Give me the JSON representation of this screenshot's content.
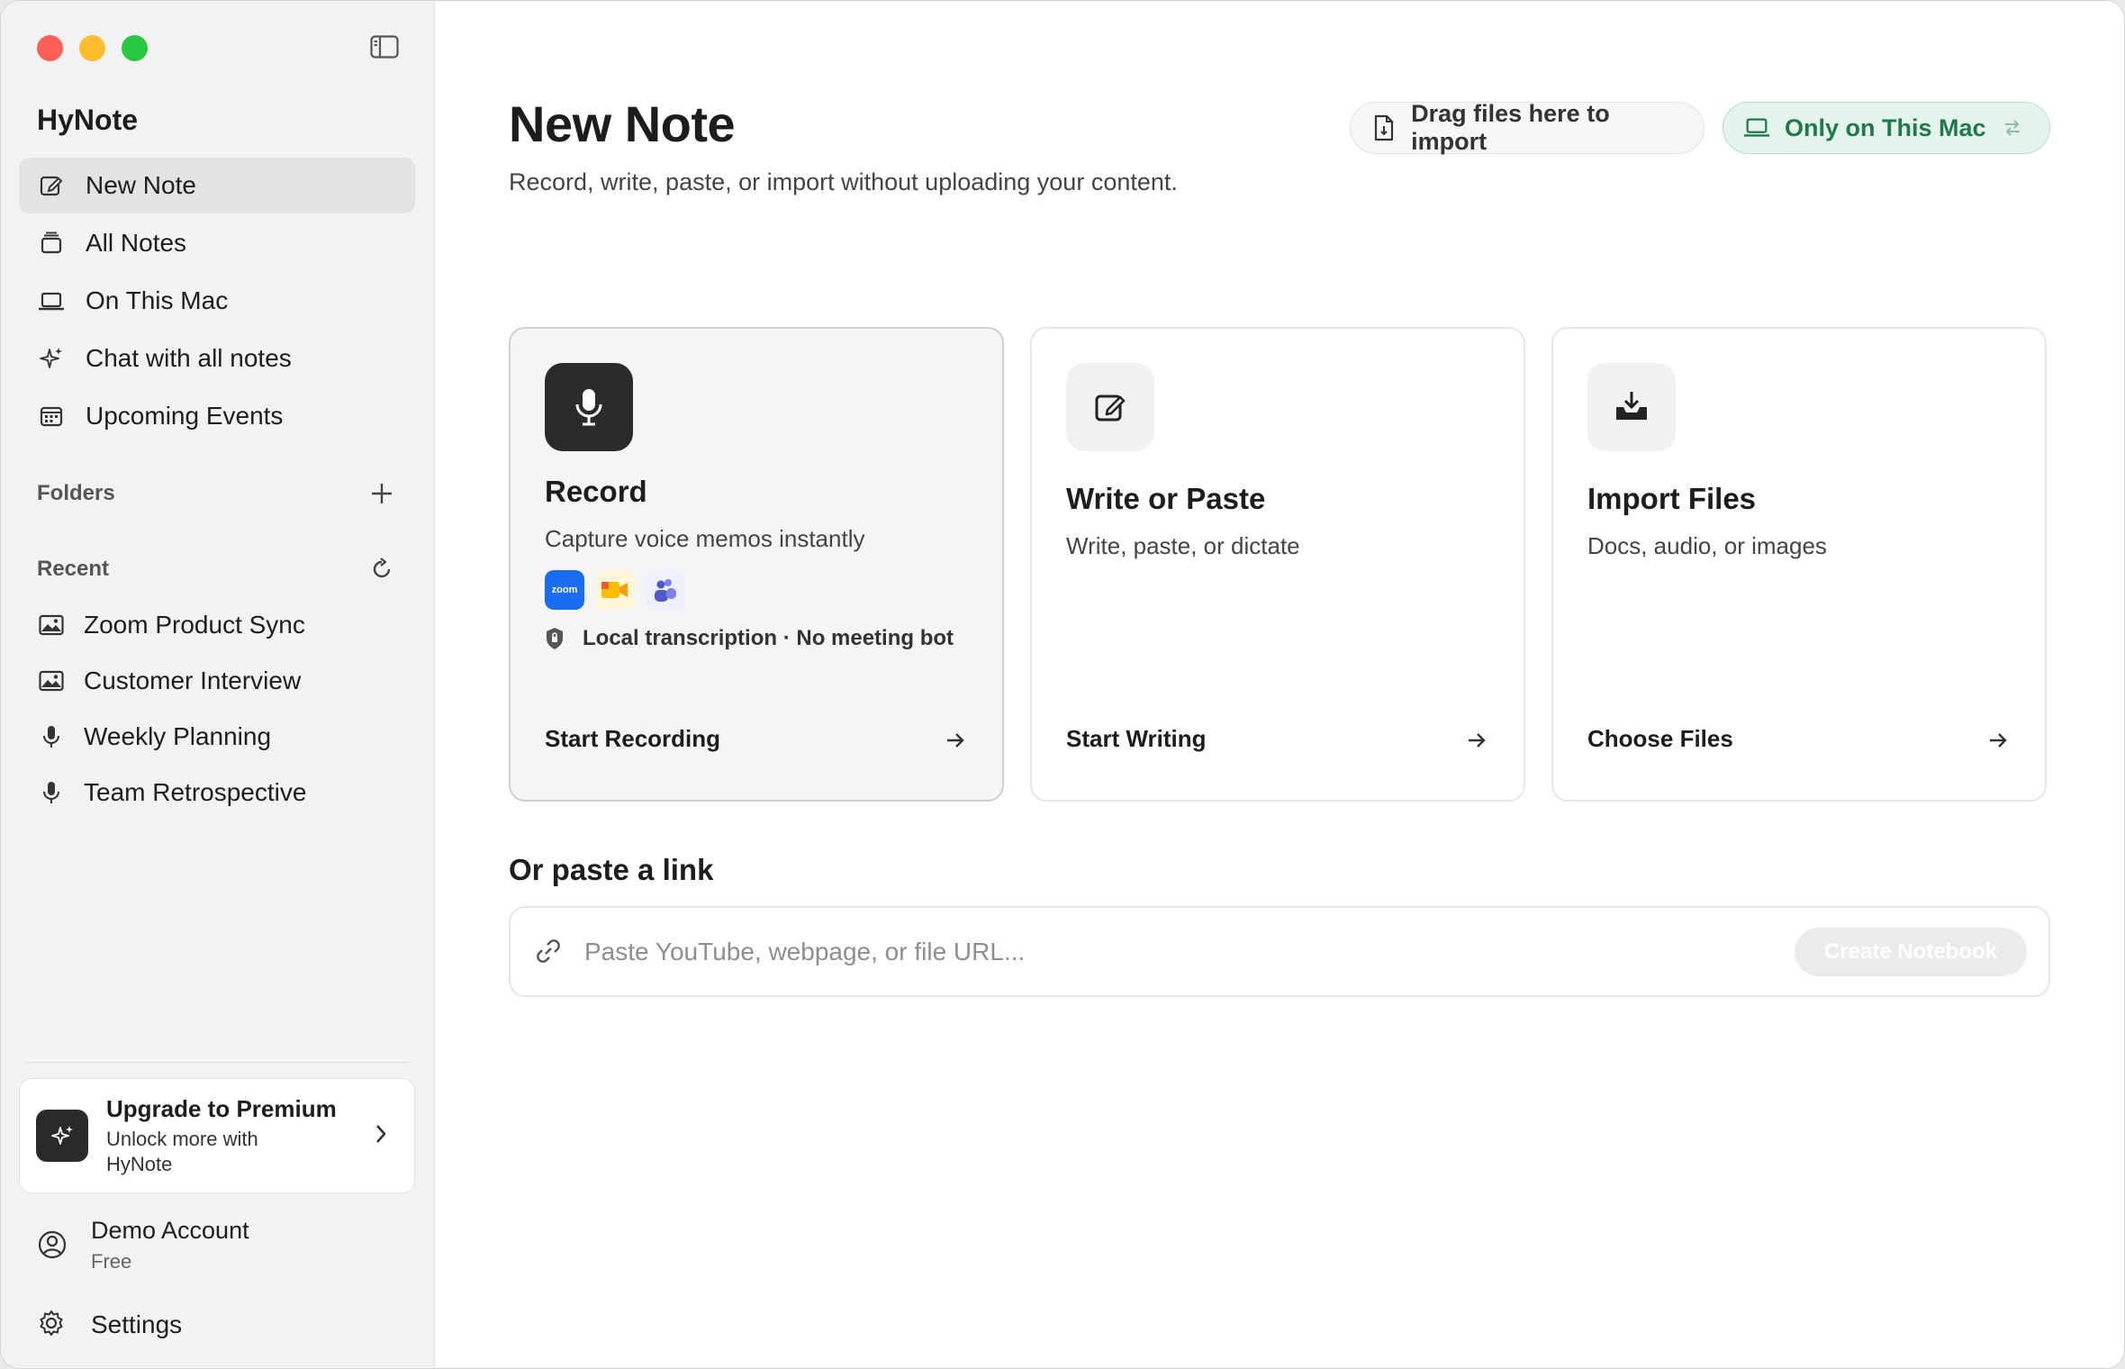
{
  "app": {
    "name": "HyNote"
  },
  "sidebar": {
    "nav": [
      {
        "label": "New Note",
        "icon": "compose-icon",
        "active": true
      },
      {
        "label": "All Notes",
        "icon": "stack-icon"
      },
      {
        "label": "On This Mac",
        "icon": "laptop-icon"
      },
      {
        "label": "Chat with all notes",
        "icon": "sparkle-icon"
      },
      {
        "label": "Upcoming Events",
        "icon": "calendar-icon"
      }
    ],
    "folders_label": "Folders",
    "recent_label": "Recent",
    "recent": [
      {
        "label": "Zoom Product Sync",
        "icon": "image-icon"
      },
      {
        "label": "Customer Interview",
        "icon": "image-icon"
      },
      {
        "label": "Weekly Planning",
        "icon": "mic-icon"
      },
      {
        "label": "Team Retrospective",
        "icon": "mic-icon"
      }
    ],
    "premium": {
      "title": "Upgrade to Premium",
      "subtitle": "Unlock more with HyNote"
    },
    "account": {
      "name": "Demo Account",
      "plan": "Free"
    },
    "settings_label": "Settings"
  },
  "main": {
    "title": "New Note",
    "subtitle": "Record, write, paste, or import without uploading your content.",
    "drag_label": "Drag files here to import",
    "storage_label": "Only on This Mac",
    "storage_color": "#1e7a48",
    "cards": [
      {
        "title": "Record",
        "desc": "Capture voice memos instantly",
        "cta": "Start Recording",
        "local": "Local transcription · No meeting bot",
        "apps": [
          "zoom",
          "google-meet",
          "teams"
        ],
        "zoom_label": "zoom"
      },
      {
        "title": "Write or Paste",
        "desc": "Write, paste, or dictate",
        "cta": "Start Writing"
      },
      {
        "title": "Import Files",
        "desc": "Docs, audio, or images",
        "cta": "Choose Files"
      }
    ],
    "paste": {
      "heading": "Or paste a link",
      "placeholder": "Paste YouTube, webpage, or file URL...",
      "button": "Create Notebook"
    }
  }
}
